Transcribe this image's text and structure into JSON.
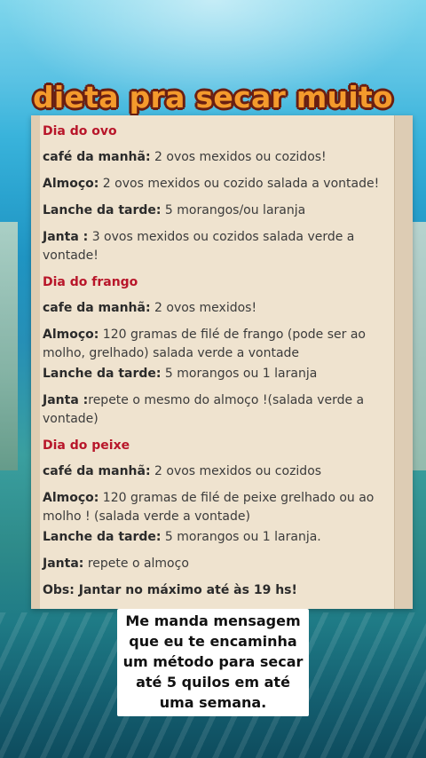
{
  "title": "dieta pra secar muito",
  "sections": [
    {
      "day": "Dia do ovo",
      "items": [
        {
          "label": "café da manhã:",
          "text": " 2 ovos mexidos ou cozidos!"
        },
        {
          "label": "Almoço:",
          "text": " 2 ovos mexidos ou cozido salada a vontade!"
        },
        {
          "label": "Lanche da tarde:",
          "text": " 5 morangos/ou laranja"
        },
        {
          "label": "Janta :",
          "text": " 3 ovos mexidos ou cozidos salada verde a vontade!"
        }
      ]
    },
    {
      "day": "Dia do frango",
      "items": [
        {
          "label": "cafe da manhã:",
          "text": " 2 ovos mexidos!"
        },
        {
          "label": "Almoço:",
          "text": " 120 gramas de filé de frango (pode ser ao molho, grelhado) salada verde a vontade"
        },
        {
          "label": "Lanche da tarde:",
          "text": " 5 morangos ou 1 laranja"
        },
        {
          "label": "Janta :",
          "text": "repete o mesmo do almoço !(salada verde a vontade)"
        }
      ]
    },
    {
      "day": "Dia do peixe",
      "items": [
        {
          "label": "café da manhã:",
          "text": " 2 ovos mexidos ou cozidos"
        },
        {
          "label": "Almoço:",
          "text": " 120 gramas de filé de peixe grelhado ou ao molho ! (salada verde a vontade)"
        },
        {
          "label": "Lanche da tarde:",
          "text": " 5 morangos ou 1 laranja."
        },
        {
          "label": "Janta:",
          "text": " repete o almoço"
        }
      ]
    }
  ],
  "obs": "Obs: Jantar no máximo até às 19 hs!",
  "caption": "Me manda mensagem que eu te encaminha um método para secar até 5 quilos em até uma semana.",
  "colors": {
    "title": "#f49a2c",
    "title_outline": "#6a1f12",
    "day_heading": "#b8162a",
    "card_bg": "#efe3cf"
  }
}
